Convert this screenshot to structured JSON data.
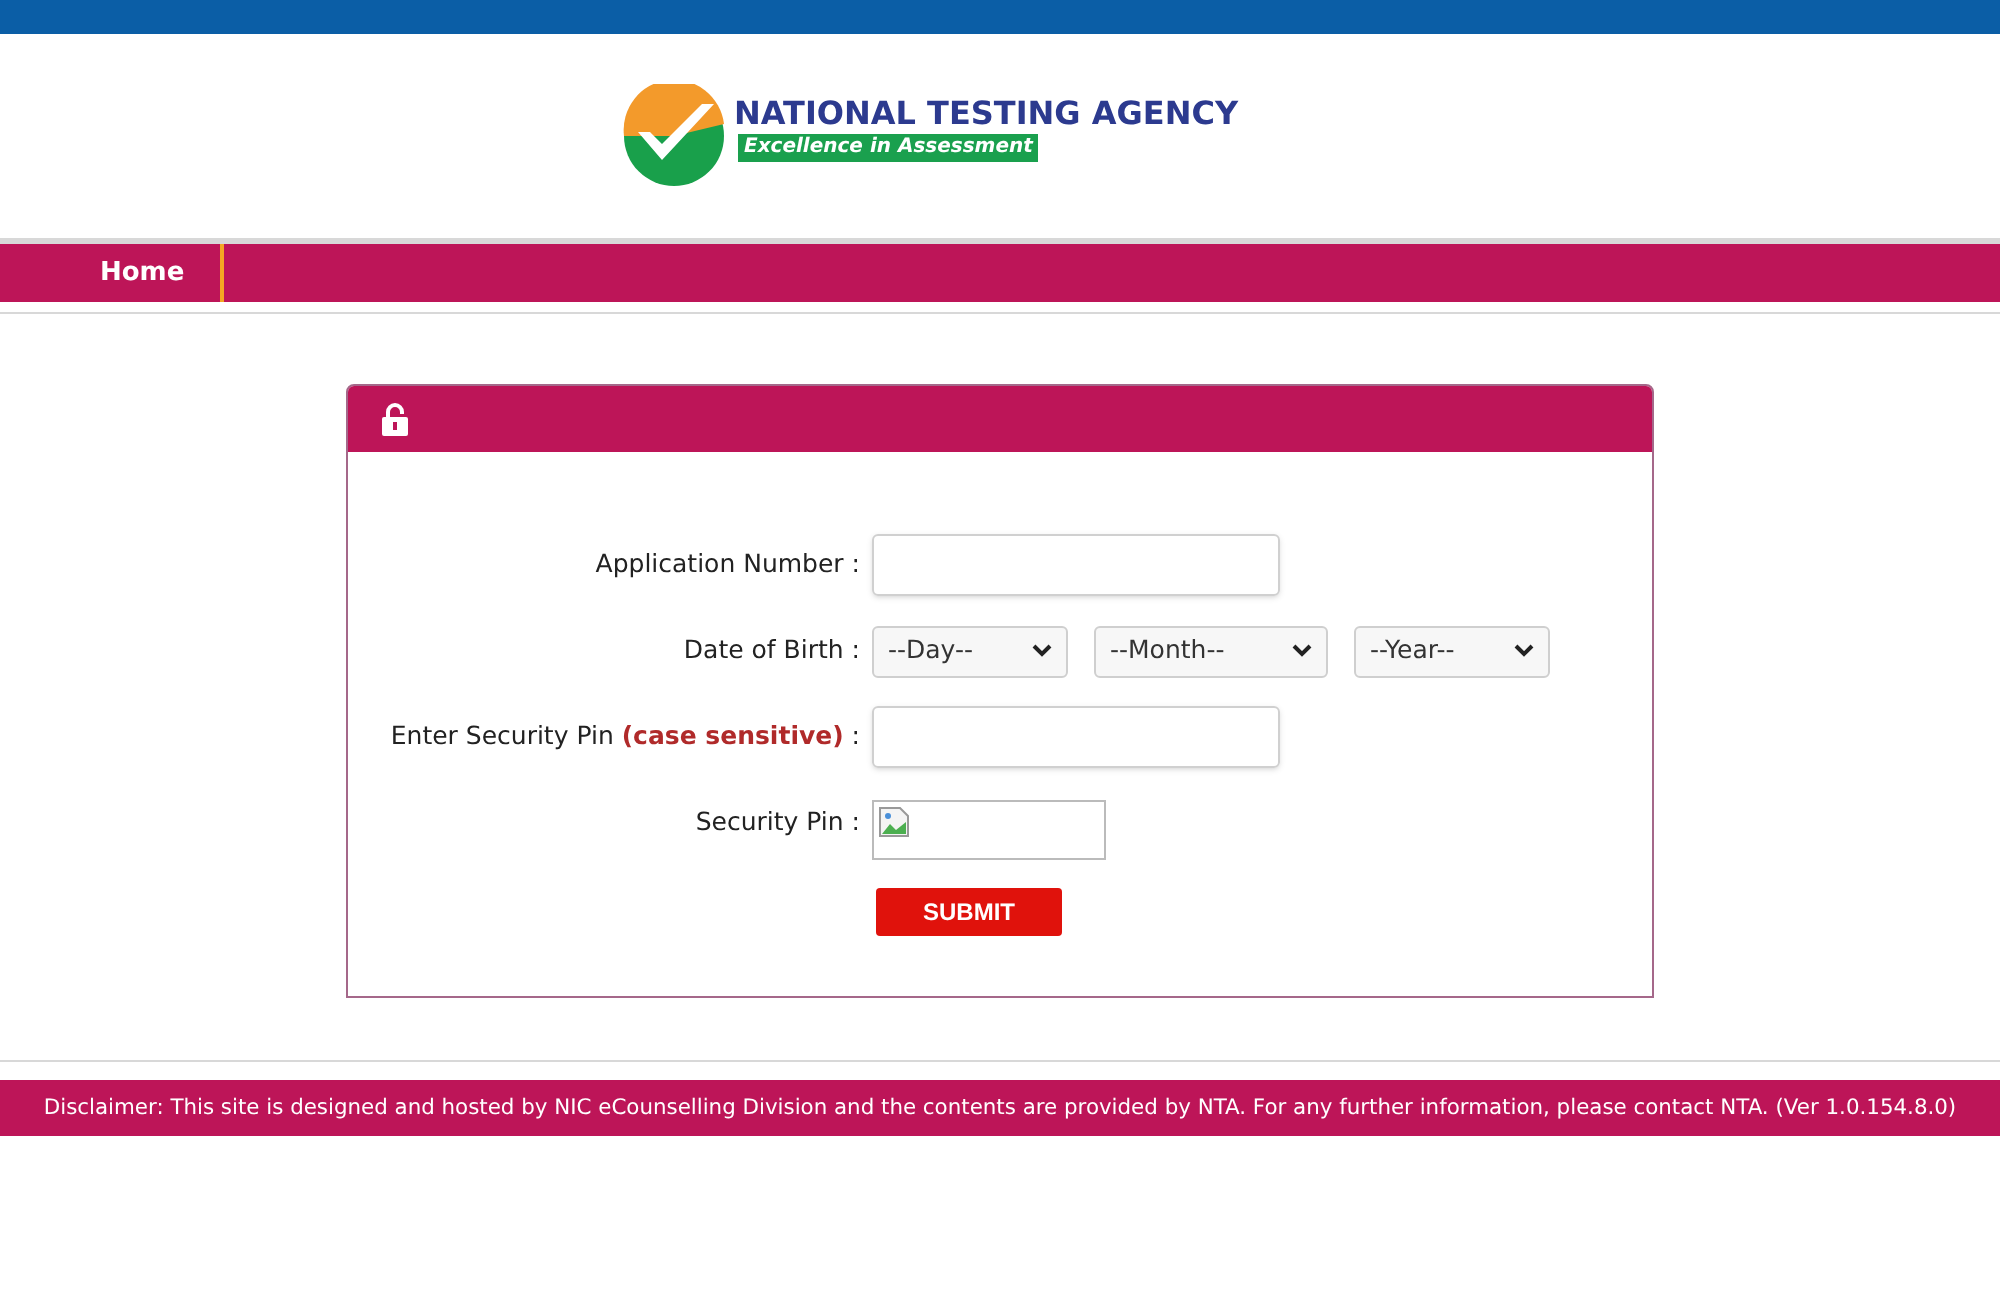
{
  "header": {
    "logo_title": "NATIONAL TESTING AGENCY",
    "logo_tagline": "Excellence in Assessment"
  },
  "nav": {
    "items": [
      {
        "label": "Home"
      }
    ]
  },
  "form": {
    "fields": [
      {
        "kind": "text",
        "label": "Application Number :"
      },
      {
        "kind": "selects",
        "label": "Date of Birth :",
        "options": [
          "--Day--",
          "--Month--",
          "--Year--"
        ]
      },
      {
        "kind": "text",
        "label": "Enter Security Pin **(case sensitive)** :"
      },
      {
        "kind": "captcha",
        "label": "Security Pin :"
      }
    ],
    "submit": "SUBMIT"
  },
  "footer": {
    "disclaimer": "Disclaimer: This site is designed and hosted by NIC eCounselling Division and the contents are provided by NTA. For any further information, please contact NTA. (Ver 1.0.154.8.0)"
  }
}
